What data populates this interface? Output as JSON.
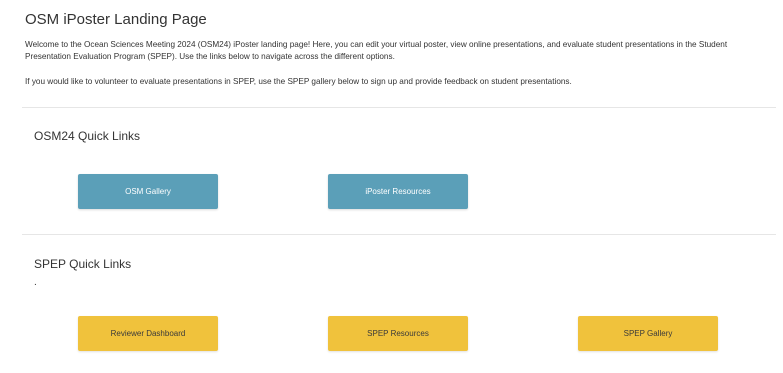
{
  "page": {
    "title": "OSM iPoster Landing Page",
    "intro": "Welcome to the Ocean Sciences Meeting 2024 (OSM24) iPoster landing page! Here, you can edit your virtual poster, view online presentations, and evaluate student presentations in the Student Presentation Evaluation Program (SPEP). Use the links below to navigate across the different options.",
    "volunteer_text": "If you would like to volunteer to evaluate presentations in SPEP, use the SPEP gallery below to sign up and provide feedback on student presentations."
  },
  "osm_section": {
    "heading": "OSM24 Quick Links",
    "buttons": [
      {
        "label": "OSM Gallery"
      },
      {
        "label": "iPoster Resources"
      }
    ]
  },
  "spep_section": {
    "heading": "SPEP Quick Links",
    "note": ".",
    "buttons": [
      {
        "label": "Reviewer Dashboard"
      },
      {
        "label": "SPEP Resources"
      },
      {
        "label": "SPEP Gallery"
      }
    ]
  },
  "colors": {
    "osm_button": "#5b9fb8",
    "spep_button": "#f0c23c",
    "text": "#333333"
  }
}
